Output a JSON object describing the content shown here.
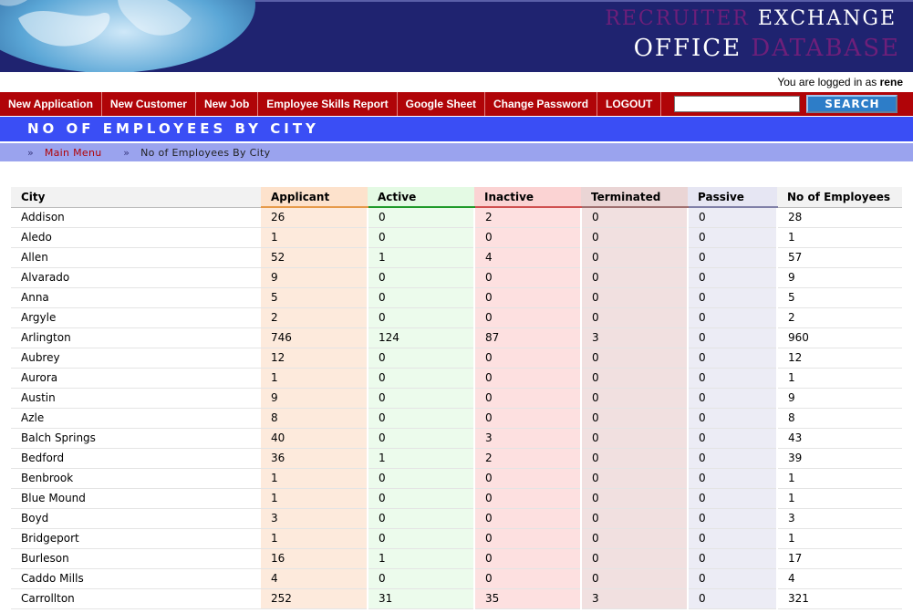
{
  "header": {
    "title_line1_part1": "RECRUITER",
    "title_line1_part2": "EXCHANGE",
    "title_line2_part1": "OFFICE",
    "title_line2_part2": "DATABASE"
  },
  "login": {
    "prefix": "You are logged in as",
    "user": "rene"
  },
  "nav": {
    "items": [
      "New Application",
      "New Customer",
      "New Job",
      "Employee Skills Report",
      "Google Sheet",
      "Change Password",
      "LOGOUT"
    ],
    "search_value": "",
    "search_button": "SEARCH"
  },
  "page": {
    "title": "NO OF EMPLOYEES BY CITY"
  },
  "breadcrumb": {
    "sep": "»",
    "main_menu": "Main Menu",
    "current": "No of Employees By City"
  },
  "table": {
    "headers": [
      "City",
      "Applicant",
      "Active",
      "Inactive",
      "Terminated",
      "Passive",
      "No of Employees"
    ],
    "rows": [
      [
        "Addison",
        "26",
        "0",
        "2",
        "0",
        "0",
        "28"
      ],
      [
        "Aledo",
        "1",
        "0",
        "0",
        "0",
        "0",
        "1"
      ],
      [
        "Allen",
        "52",
        "1",
        "4",
        "0",
        "0",
        "57"
      ],
      [
        "Alvarado",
        "9",
        "0",
        "0",
        "0",
        "0",
        "9"
      ],
      [
        "Anna",
        "5",
        "0",
        "0",
        "0",
        "0",
        "5"
      ],
      [
        "Argyle",
        "2",
        "0",
        "0",
        "0",
        "0",
        "2"
      ],
      [
        "Arlington",
        "746",
        "124",
        "87",
        "3",
        "0",
        "960"
      ],
      [
        "Aubrey",
        "12",
        "0",
        "0",
        "0",
        "0",
        "12"
      ],
      [
        "Aurora",
        "1",
        "0",
        "0",
        "0",
        "0",
        "1"
      ],
      [
        "Austin",
        "9",
        "0",
        "0",
        "0",
        "0",
        "9"
      ],
      [
        "Azle",
        "8",
        "0",
        "0",
        "0",
        "0",
        "8"
      ],
      [
        "Balch Springs",
        "40",
        "0",
        "3",
        "0",
        "0",
        "43"
      ],
      [
        "Bedford",
        "36",
        "1",
        "2",
        "0",
        "0",
        "39"
      ],
      [
        "Benbrook",
        "1",
        "0",
        "0",
        "0",
        "0",
        "1"
      ],
      [
        "Blue Mound",
        "1",
        "0",
        "0",
        "0",
        "0",
        "1"
      ],
      [
        "Boyd",
        "3",
        "0",
        "0",
        "0",
        "0",
        "3"
      ],
      [
        "Bridgeport",
        "1",
        "0",
        "0",
        "0",
        "0",
        "1"
      ],
      [
        "Burleson",
        "16",
        "1",
        "0",
        "0",
        "0",
        "17"
      ],
      [
        "Caddo Mills",
        "4",
        "0",
        "0",
        "0",
        "0",
        "4"
      ],
      [
        "Carrollton",
        "252",
        "31",
        "35",
        "3",
        "0",
        "321"
      ]
    ]
  }
}
